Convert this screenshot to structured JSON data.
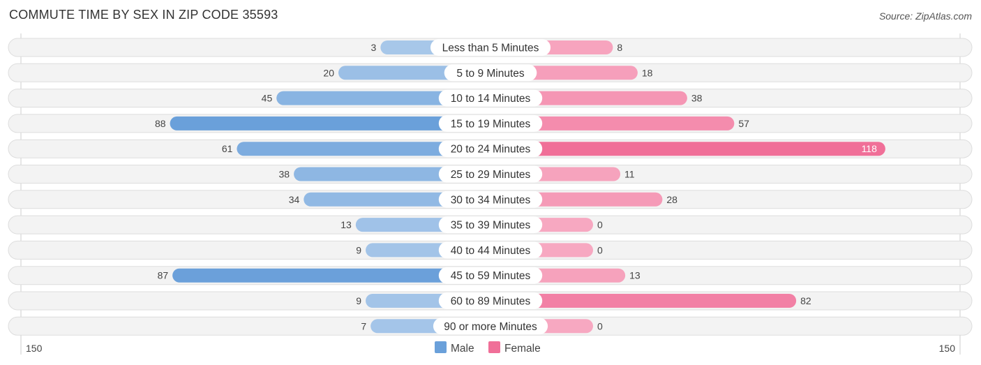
{
  "title": "COMMUTE TIME BY SEX IN ZIP CODE 35593",
  "source": "Source: ZipAtlas.com",
  "colors": {
    "male": "#6aa0da",
    "male_light": "#a9c8ea",
    "female": "#f06f98",
    "female_light": "#f7a8c1",
    "row_bg": "#f3f3f3"
  },
  "chart_data": {
    "type": "bar",
    "orientation": "horizontal-diverging",
    "title": "COMMUTE TIME BY SEX IN ZIP CODE 35593",
    "categories": [
      "Less than 5 Minutes",
      "5 to 9 Minutes",
      "10 to 14 Minutes",
      "15 to 19 Minutes",
      "20 to 24 Minutes",
      "25 to 29 Minutes",
      "30 to 34 Minutes",
      "35 to 39 Minutes",
      "40 to 44 Minutes",
      "45 to 59 Minutes",
      "60 to 89 Minutes",
      "90 or more Minutes"
    ],
    "series": [
      {
        "name": "Male",
        "values": [
          3,
          20,
          45,
          88,
          61,
          38,
          34,
          13,
          9,
          87,
          9,
          7
        ]
      },
      {
        "name": "Female",
        "values": [
          8,
          18,
          38,
          57,
          118,
          11,
          28,
          0,
          0,
          13,
          82,
          0
        ]
      }
    ],
    "axis": {
      "left_label": "150",
      "right_label": "150",
      "max": 150
    },
    "legend": {
      "position": "bottom-center",
      "entries": [
        "Male",
        "Female"
      ]
    },
    "grid": false
  }
}
